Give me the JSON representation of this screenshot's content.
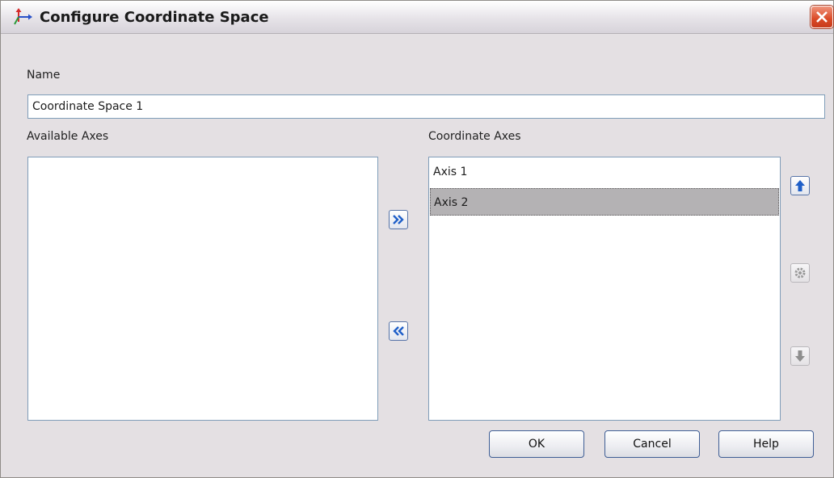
{
  "window": {
    "title": "Configure Coordinate Space"
  },
  "name": {
    "label": "Name",
    "value": "Coordinate Space 1"
  },
  "available_axes": {
    "label": "Available Axes",
    "items": []
  },
  "coordinate_axes": {
    "label": "Coordinate Axes",
    "items": [
      "Axis 1",
      "Axis 2"
    ],
    "selected": "Axis 2"
  },
  "buttons": {
    "ok": "OK",
    "cancel": "Cancel",
    "help": "Help"
  },
  "icons": {
    "app": "coordinate-axes-icon",
    "close": "close-icon",
    "add": "double-chevron-right-icon",
    "remove": "double-chevron-left-icon",
    "move_up": "arrow-up-icon",
    "edit": "settings-icon",
    "move_down": "arrow-down-icon"
  },
  "colors": {
    "accent": "#1f5fc8",
    "selection": "#b4b2b4",
    "close": "#da4a26"
  }
}
